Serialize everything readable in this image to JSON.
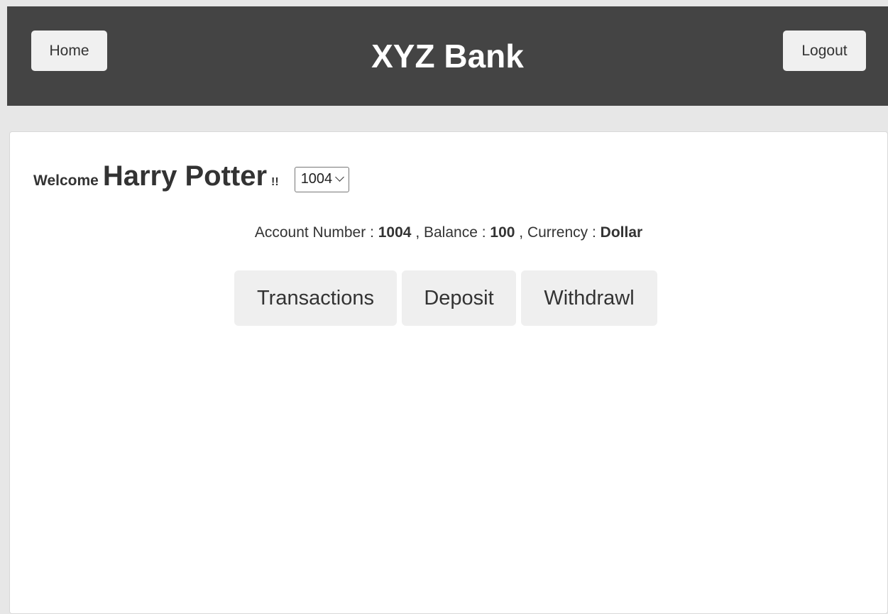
{
  "header": {
    "brand": "XYZ Bank",
    "home_label": "Home",
    "logout_label": "Logout"
  },
  "welcome": {
    "prefix": "Welcome",
    "customer_name": "Harry Potter",
    "suffix": "!!",
    "selected_account": "1004"
  },
  "account_info": {
    "number_label": "Account Number :",
    "number": "1004",
    "balance_label": ", Balance :",
    "balance": "100",
    "currency_label": ", Currency :",
    "currency": "Dollar"
  },
  "actions": {
    "transactions_label": "Transactions",
    "deposit_label": "Deposit",
    "withdrawl_label": "Withdrawl"
  },
  "colors": {
    "header_bg": "#444444",
    "page_bg": "#e7e7e7",
    "button_bg": "#efefef"
  },
  "icons": {
    "select_arrow": "chevron-down-icon"
  }
}
